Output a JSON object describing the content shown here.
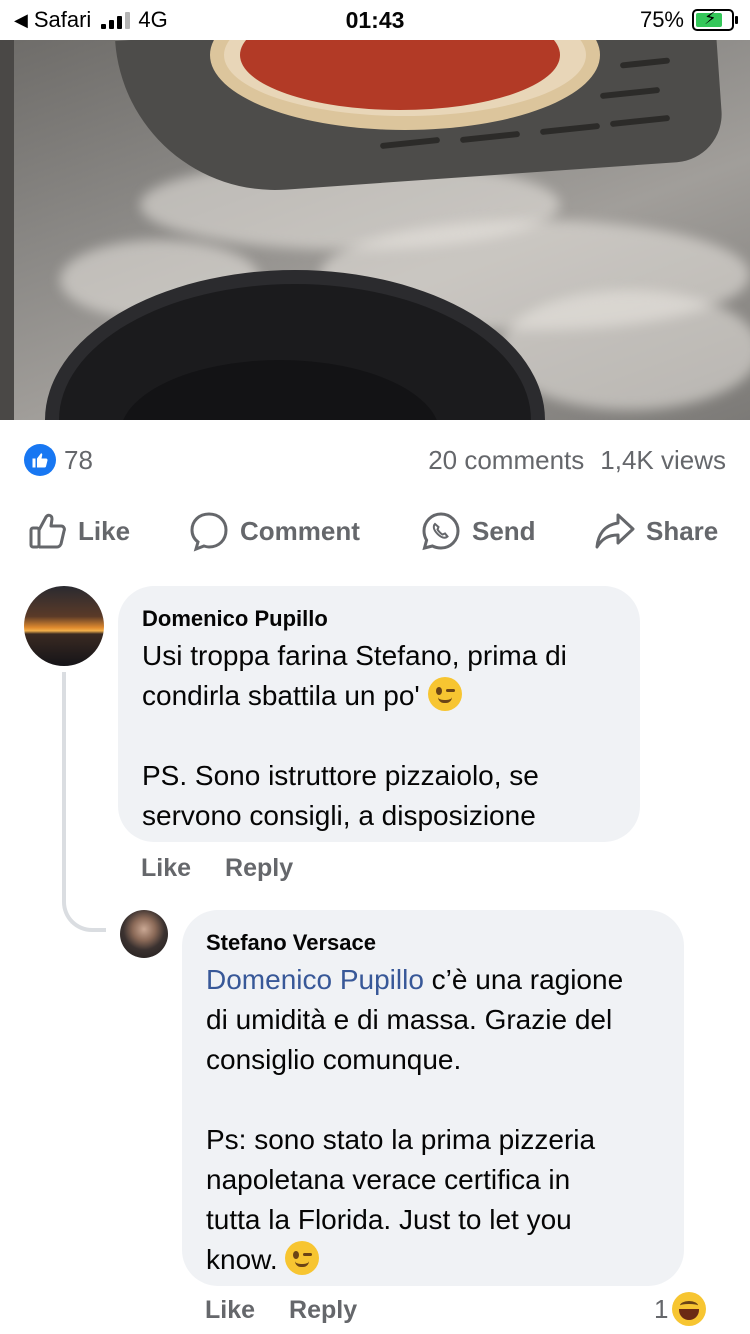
{
  "status_bar": {
    "back_app": "Safari",
    "network": "4G",
    "time": "01:43",
    "battery_percent": "75%",
    "battery_level": 0.75,
    "charging": true
  },
  "video": {
    "description_icon": "video-frame"
  },
  "stats": {
    "like_count": "78",
    "comments": "20 comments",
    "views": "1,4K views"
  },
  "actions": {
    "like": "Like",
    "comment": "Comment",
    "send": "Send",
    "share": "Share"
  },
  "comments": [
    {
      "author": "Domenico Pupillo",
      "text_line1": "Usi troppa farina Stefano,  prima di\ncondirla sbattila un po'",
      "text_line2": "PS.  Sono istruttore pizzaiolo, se\nservono consigli, a disposizione",
      "like": "Like",
      "reply": "Reply"
    },
    {
      "author": "Stefano Versace",
      "mention": "Domenico Pupillo",
      "text_after_mention": " c’è una ragione\ndi umidità e di massa. Grazie del\nconsiglio comunque.",
      "text_ps": "Ps: sono stato la prima pizzeria\nnapoletana verace certifica in\ntutta la Florida. Just to let you\nknow.",
      "like": "Like",
      "reply": "Reply",
      "reaction_count": "1"
    }
  ],
  "colors": {
    "accent": "#1877f2",
    "muted": "#65676b",
    "bubble": "#f0f2f5",
    "mention": "#385898"
  }
}
